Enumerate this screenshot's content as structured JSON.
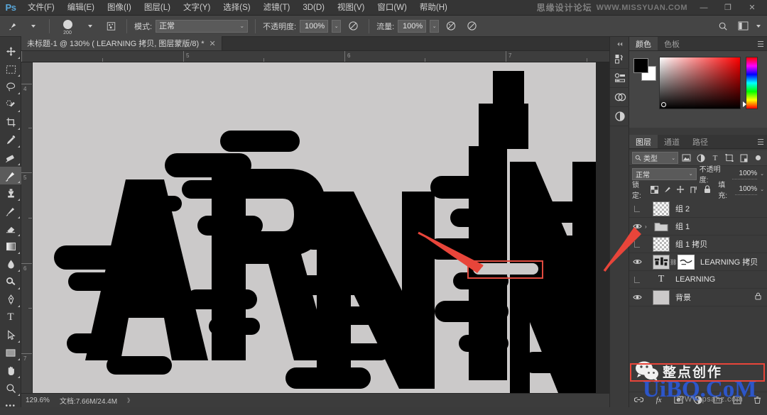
{
  "app": {
    "logo": "Ps"
  },
  "menubar": {
    "items": [
      {
        "label": "文件(F)",
        "name": "menu-file"
      },
      {
        "label": "编辑(E)",
        "name": "menu-edit"
      },
      {
        "label": "图像(I)",
        "name": "menu-image"
      },
      {
        "label": "图层(L)",
        "name": "menu-layer"
      },
      {
        "label": "文字(Y)",
        "name": "menu-type"
      },
      {
        "label": "选择(S)",
        "name": "menu-select"
      },
      {
        "label": "滤镜(T)",
        "name": "menu-filter"
      },
      {
        "label": "3D(D)",
        "name": "menu-3d"
      },
      {
        "label": "视图(V)",
        "name": "menu-view"
      },
      {
        "label": "窗口(W)",
        "name": "menu-window"
      },
      {
        "label": "帮助(H)",
        "name": "menu-help"
      }
    ],
    "watermark_cn": "思缘设计论坛",
    "watermark_en": "WWW.MISSYUAN.COM",
    "minimize": "—",
    "restore": "❐",
    "close": "✕"
  },
  "optionsbar": {
    "brush_size": "200",
    "mode_label": "模式:",
    "mode_value": "正常",
    "opacity_label": "不透明度:",
    "opacity_value": "100%",
    "flow_label": "流量:",
    "flow_value": "100%"
  },
  "toolbar": {
    "tools": [
      {
        "name": "move-tool",
        "label": "移动工具"
      },
      {
        "name": "marquee-tool",
        "label": "矩形选框工具"
      },
      {
        "name": "lasso-tool",
        "label": "套索工具"
      },
      {
        "name": "quick-selection-tool",
        "label": "快速选择工具"
      },
      {
        "name": "crop-tool",
        "label": "裁剪工具"
      },
      {
        "name": "eyedropper-tool",
        "label": "吸管工具"
      },
      {
        "name": "healing-brush-tool",
        "label": "污点修复画笔工具"
      },
      {
        "name": "brush-tool",
        "label": "画笔工具"
      },
      {
        "name": "clone-stamp-tool",
        "label": "仿制图章工具"
      },
      {
        "name": "history-brush-tool",
        "label": "历史记录画笔工具"
      },
      {
        "name": "eraser-tool",
        "label": "橡皮擦工具"
      },
      {
        "name": "gradient-tool",
        "label": "渐变工具"
      },
      {
        "name": "blur-tool",
        "label": "模糊工具"
      },
      {
        "name": "dodge-tool",
        "label": "减淡工具"
      },
      {
        "name": "pen-tool",
        "label": "钢笔工具"
      },
      {
        "name": "type-tool",
        "label": "横排文字工具"
      },
      {
        "name": "path-selection-tool",
        "label": "路径选择工具"
      },
      {
        "name": "rectangle-tool",
        "label": "矩形工具"
      },
      {
        "name": "hand-tool",
        "label": "抓手工具"
      },
      {
        "name": "zoom-tool",
        "label": "缩放工具"
      },
      {
        "name": "more-tools",
        "label": "编辑工具栏"
      }
    ],
    "active": "brush-tool"
  },
  "document": {
    "tab_title": "未标题-1 @ 130% ( LEARNING 拷贝, 图层蒙版/8) *",
    "close_label": "✕",
    "canvas_text": "LEARNING",
    "canvas_bg_color": "#cbc9c9",
    "artwork_color": "#000000",
    "ruler_h_labels": [
      "5",
      "6",
      "7"
    ],
    "ruler_v_labels": [
      "4",
      "5",
      "6",
      "7"
    ]
  },
  "annotations": {
    "arrow_color": "#e8453a",
    "canvas_box_name": "erased-notch-highlight",
    "layer_box_name": "layer-visibility-highlight"
  },
  "statusbar": {
    "zoom": "129.6%",
    "doc_label": "文档:7.66M/24.4M",
    "expand": "》"
  },
  "dockrail": {
    "buttons": [
      {
        "name": "history-panel-icon"
      },
      {
        "name": "properties-panel-icon"
      },
      {
        "name": "adjustments-panel-icon"
      },
      {
        "name": "styles-panel-icon"
      }
    ],
    "collapse": "⏴⏴"
  },
  "color_panel": {
    "tabs": [
      {
        "label": "颜色",
        "name": "tab-color",
        "selected": true
      },
      {
        "label": "色板",
        "name": "tab-swatches",
        "selected": false
      }
    ],
    "menu_glyph": "☰",
    "foreground": "#000000",
    "background": "#ffffff"
  },
  "layers_panel": {
    "tabs": [
      {
        "label": "图层",
        "name": "tab-layers",
        "selected": true
      },
      {
        "label": "通道",
        "name": "tab-channels",
        "selected": false
      },
      {
        "label": "路径",
        "name": "tab-paths",
        "selected": false
      }
    ],
    "menu_glyph": "☰",
    "filter_label": "类型",
    "filter_icons": [
      "pixel-filter-icon",
      "adjustment-filter-icon",
      "type-filter-icon",
      "shape-filter-icon",
      "smart-object-filter-icon"
    ],
    "toggle_filter": "filter-power-icon",
    "blend_mode": "正常",
    "opacity_label": "不透明度:",
    "opacity_value": "100%",
    "lock_label": "锁定:",
    "lock_icons": [
      "lock-transparent-icon",
      "lock-image-icon",
      "lock-position-icon",
      "lock-artboard-icon",
      "lock-all-icon"
    ],
    "fill_label": "填充:",
    "fill_value": "100%",
    "layers": [
      {
        "name": "组 2",
        "type": "group",
        "visible": false,
        "selected": false,
        "thumb": "checker",
        "locked": false
      },
      {
        "name": "组 1",
        "type": "group",
        "visible": true,
        "selected": false,
        "thumb": "folder",
        "locked": false,
        "expander": "›"
      },
      {
        "name": "组 1 拷贝",
        "type": "group",
        "visible": false,
        "selected": false,
        "thumb": "checker",
        "locked": false,
        "highlighted": true
      },
      {
        "name": "LEARNING 拷贝",
        "type": "raster-with-mask",
        "visible": true,
        "selected": false,
        "thumb": "art",
        "locked": false
      },
      {
        "name": "LEARNING",
        "type": "text",
        "visible": false,
        "selected": false,
        "thumb": "type",
        "locked": false
      },
      {
        "name": "背景",
        "type": "raster",
        "visible": true,
        "selected": false,
        "thumb": "solid",
        "locked": true,
        "lock_glyph": "🔒"
      }
    ],
    "bottom_buttons": [
      {
        "name": "link-layers-button",
        "glyph": "🔗"
      },
      {
        "name": "layer-style-button",
        "glyph": "fx"
      },
      {
        "name": "add-mask-button",
        "glyph": "◧"
      },
      {
        "name": "adjustment-layer-button",
        "glyph": "◑"
      },
      {
        "name": "new-group-button",
        "glyph": "🗀"
      },
      {
        "name": "new-layer-button",
        "glyph": "⊞"
      },
      {
        "name": "delete-layer-button",
        "glyph": "🗑"
      }
    ]
  },
  "overlay_watermarks": {
    "wechat_brand": "整点创作",
    "site": "UiBQ.CoM",
    "site_sub": "WWW.psahz.com"
  }
}
